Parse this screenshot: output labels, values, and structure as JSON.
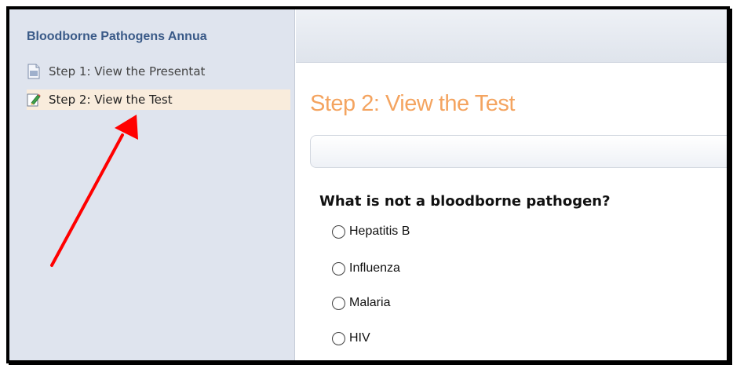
{
  "sidebar": {
    "title": "Bloodborne Pathogens Annua",
    "items": [
      {
        "label": "Step 1: View the Presentat",
        "icon": "document-icon"
      },
      {
        "label": "Step 2: View the Test",
        "icon": "edit-icon"
      }
    ]
  },
  "main": {
    "title": "Step 2: View the Test",
    "question": "What is not a bloodborne pathogen?",
    "options": [
      "Hepatitis B",
      "Influenza",
      "Malaria",
      "HIV"
    ]
  },
  "colors": {
    "title_orange": "#f4a460",
    "sidebar_bg": "#dfe4ee",
    "sidebar_title": "#3a5a88",
    "selected_item_bg": "#f9ecdc",
    "arrow": "#ff0000"
  }
}
